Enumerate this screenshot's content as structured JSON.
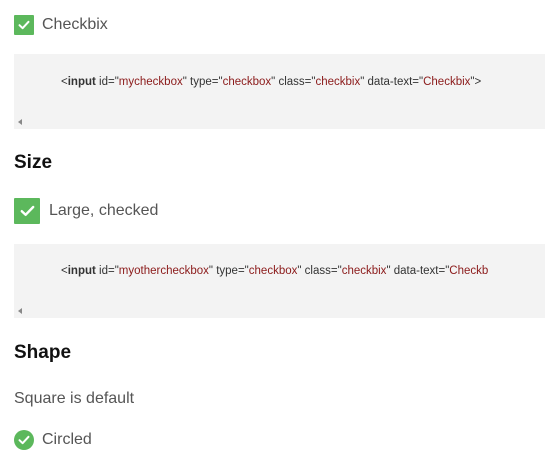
{
  "examples": [
    {
      "label": "Checkbix",
      "code": {
        "tag": "input",
        "attrs": [
          {
            "name": "id",
            "value": "mycheckbox"
          },
          {
            "name": "type",
            "value": "checkbox"
          },
          {
            "name": "class",
            "value": "checkbix"
          },
          {
            "name": "data-text",
            "value": "Checkbix"
          }
        ],
        "close": ">"
      }
    },
    {
      "label": "Large, checked",
      "code": {
        "tag": "input",
        "attrs": [
          {
            "name": "id",
            "value": "myothercheckbox"
          },
          {
            "name": "type",
            "value": "checkbox"
          },
          {
            "name": "class",
            "value": "checkbix"
          },
          {
            "name": "data-text",
            "value": "Checkb"
          }
        ]
      }
    }
  ],
  "sections": {
    "size": {
      "heading": "Size"
    },
    "shape": {
      "heading": "Shape",
      "description": "Square is default",
      "circled_label": "Circled"
    }
  },
  "colors": {
    "checkbox_green": "#5cb85c",
    "code_background": "#f3f3f3",
    "string_value": "#8b1a1a"
  },
  "icons": {
    "check": "check-icon",
    "scroll_left": "scroll-left-arrow-icon"
  }
}
